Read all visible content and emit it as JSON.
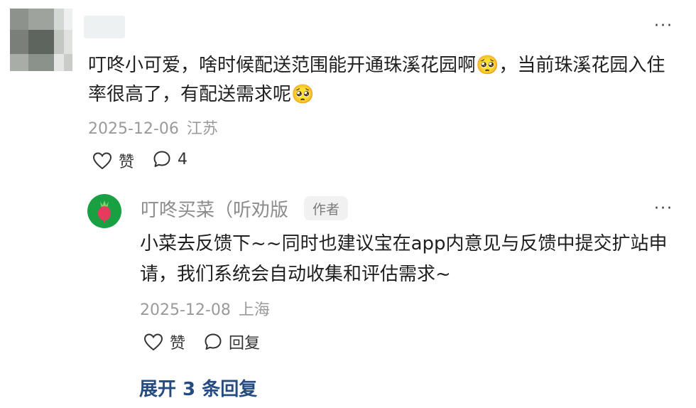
{
  "comment": {
    "text": "叮咚小可爱，啥时候配送范围能开通珠溪花园啊🥺，当前珠溪花园入住率很高了，有配送需求呢🥺",
    "date": "2025-12-06",
    "location": "江苏",
    "like_label": "赞",
    "reply_count": "4",
    "more_icon": "more-icon",
    "avatar_colors": [
      "#7a7f79",
      "#5e655f",
      "#c3c8c3",
      "#eceeed"
    ]
  },
  "reply": {
    "author": "叮咚买菜（听劝版",
    "badge": "作者",
    "text": "小菜去反馈下~~同时也建议宝在app内意见与反馈中提交扩站申请，我们系统会自动收集和评估需求~",
    "date": "2025-12-08",
    "location": "上海",
    "like_label": "赞",
    "reply_label": "回复",
    "avatar_color": "#18a043",
    "logo_icon": "radish-icon",
    "logo_color": "#e83a5e"
  },
  "expand_label": "展开 3 条回复"
}
